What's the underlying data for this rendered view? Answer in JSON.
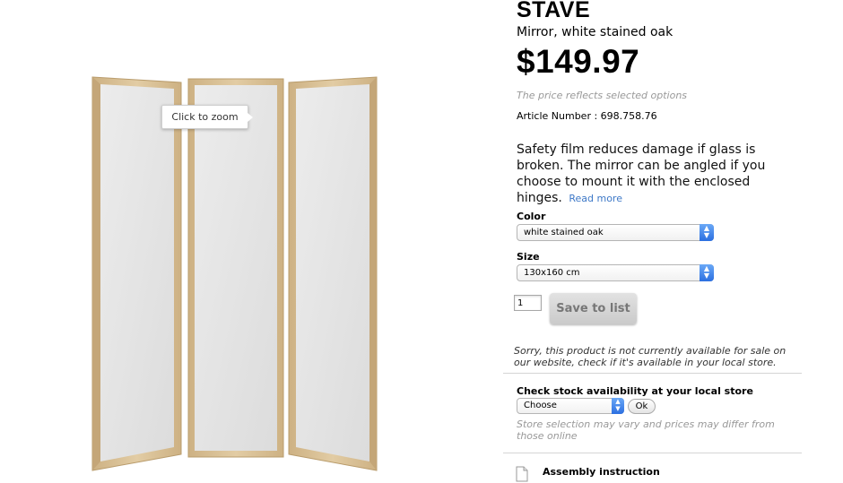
{
  "product": {
    "name": "STAVE",
    "subtitle": "Mirror, white stained oak",
    "price": "$149.97",
    "price_note": "The price reflects selected options",
    "article_number": "Article Number : 698.758.76",
    "description": "Safety film reduces damage if glass is broken. The mirror can be angled if you choose to mount it with the enclosed hinges.",
    "read_more": "Read more"
  },
  "image": {
    "zoom_tooltip": "Click to zoom",
    "frame_color": "#d9c29a",
    "glass_color": "#e8e8e8"
  },
  "options": {
    "color_label": "Color",
    "color_value": "white stained oak",
    "size_label": "Size",
    "size_value": "130x160 cm"
  },
  "purchase": {
    "quantity": "1",
    "save_label": "Save to list",
    "unavailable_note": "Sorry, this product is not currently available for sale on our website, check if it's available in your local store."
  },
  "stock": {
    "title": "Check stock availability at your local store",
    "select_value": "Choose",
    "ok_label": "Ok",
    "note": "Store selection may vary and prices may differ from those online"
  },
  "documents": {
    "assembly_label": "Assembly instruction"
  },
  "colors": {
    "link": "#3d78c7",
    "select_accent": "#2c6fe0",
    "muted_text": "#999999"
  }
}
